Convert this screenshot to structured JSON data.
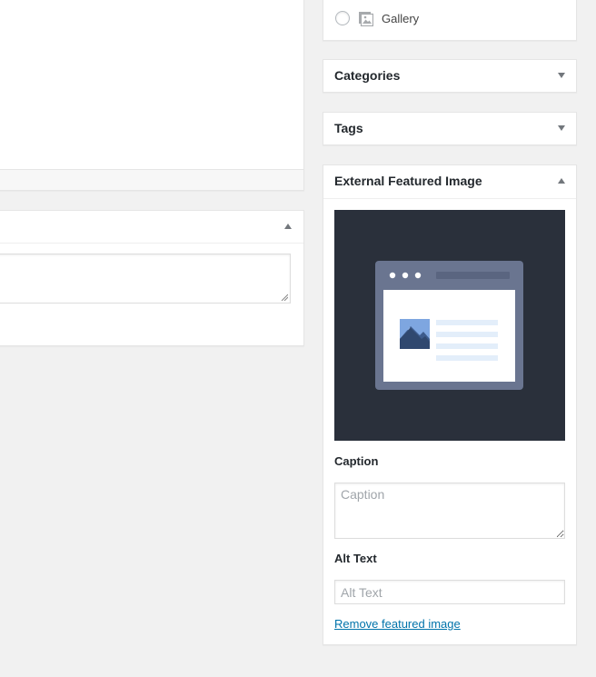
{
  "post_format": {
    "items": [
      {
        "label": "Gallery",
        "icon": "gallery-icon",
        "selected": false
      }
    ]
  },
  "categories_box": {
    "title": "Categories",
    "state": "collapsed",
    "toggle_icon": "triangle-down-icon"
  },
  "tags_box": {
    "title": "Tags",
    "state": "collapsed",
    "toggle_icon": "triangle-down-icon"
  },
  "excerpt_box": {
    "state": "expanded",
    "toggle_icon": "triangle-up-icon"
  },
  "external_featured_image": {
    "title": "External Featured Image",
    "state": "expanded",
    "toggle_icon": "triangle-up-icon",
    "preview_icon": "browser-window-image-icon",
    "caption_label": "Caption",
    "caption_placeholder": "Caption",
    "alt_label": "Alt Text",
    "alt_placeholder": "Alt Text",
    "remove_link": "Remove featured image"
  },
  "colors": {
    "page_bg": "#f1f1f1",
    "preview_bg": "#2a303b",
    "link": "#0073aa"
  }
}
